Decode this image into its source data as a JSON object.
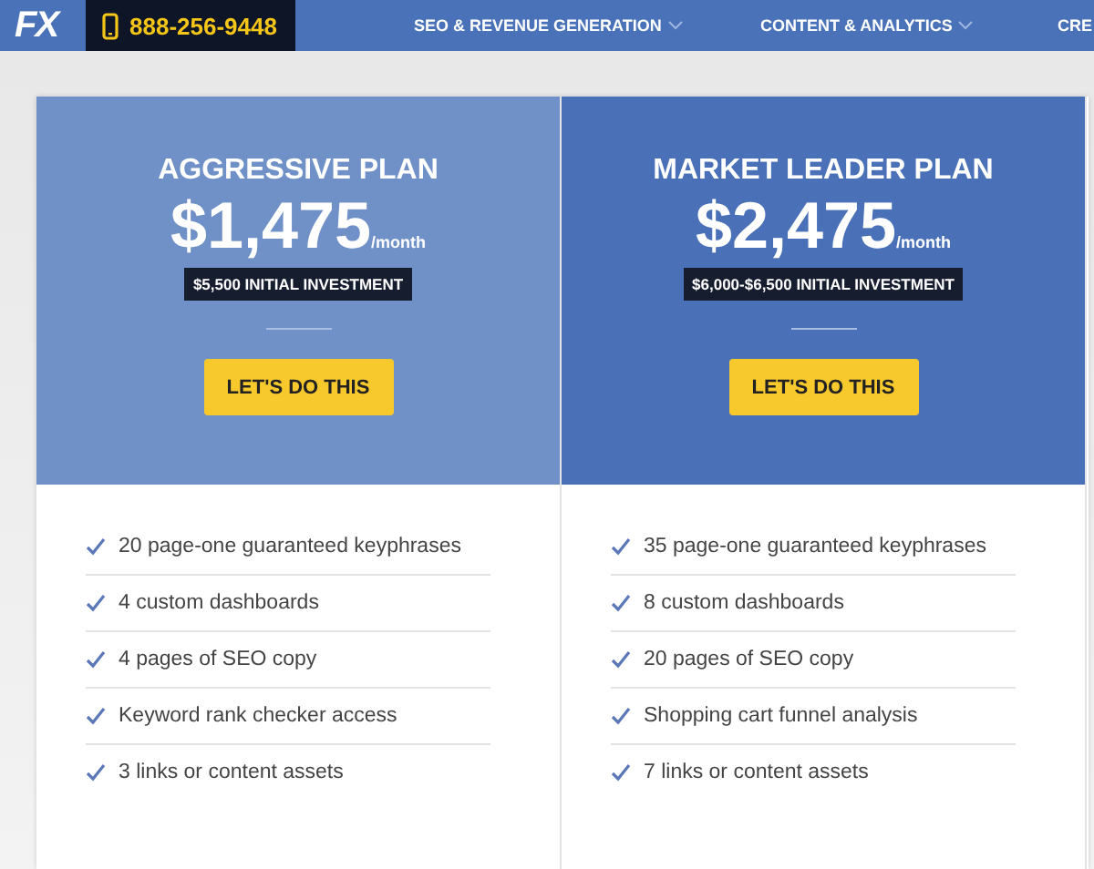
{
  "header": {
    "logo": "FX",
    "phone": "888-256-9448",
    "nav": [
      {
        "label": "SEO & REVENUE GENERATION",
        "dropdown": true
      },
      {
        "label": "CONTENT & ANALYTICS",
        "dropdown": true
      },
      {
        "label": "CRE",
        "dropdown": false
      }
    ]
  },
  "plans": [
    {
      "name": "AGGRESSIVE PLAN",
      "price": "$1,475",
      "period": "/month",
      "investment": "$5,500 INITIAL INVESTMENT",
      "button": "LET'S DO THIS",
      "color": "#7090c8",
      "features": [
        "20 page-one guaranteed keyphrases",
        "4 custom dashboards",
        "4 pages of SEO copy",
        "Keyword rank checker access",
        "3 links or content assets"
      ]
    },
    {
      "name": "MARKET LEADER PLAN",
      "price": "$2,475",
      "period": "/month",
      "investment": "$6,000-$6,500 INITIAL INVESTMENT",
      "button": "LET'S DO THIS",
      "color": "#4a70b8",
      "features": [
        "35 page-one guaranteed keyphrases",
        "8 custom dashboards",
        "20 pages of SEO copy",
        "Shopping cart funnel analysis",
        "7 links or content assets"
      ]
    }
  ]
}
